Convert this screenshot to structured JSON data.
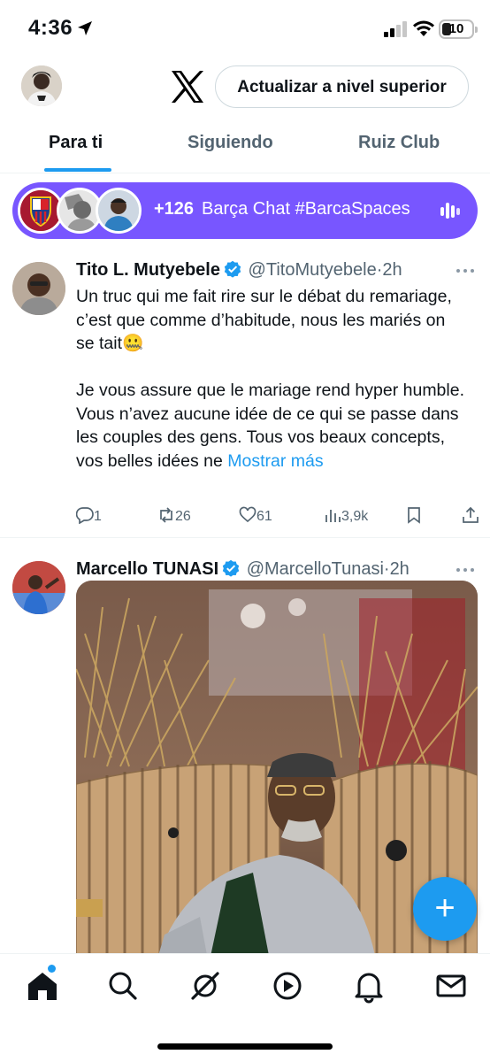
{
  "status_bar": {
    "time": "4:36",
    "battery": "10"
  },
  "header": {
    "upgrade_label": "Actualizar a nivel superior"
  },
  "tabs": [
    {
      "label": "Para ti",
      "active": true
    },
    {
      "label": "Siguiendo",
      "active": false
    },
    {
      "label": "Ruiz Club",
      "active": false
    }
  ],
  "spaces": {
    "count": "+126",
    "title": "Barça Chat #BarcaSpaces",
    "color": "#7856ff"
  },
  "tweets": [
    {
      "name": "Tito L. Mutyebele",
      "handle": "@TitoMutyebele",
      "time": "2h",
      "text": "Un truc qui me fait rire sur le débat du remariage, c’est que comme d’habitude, nous les mariés on se tait🤐\n\nJe vous assure que le mariage rend hyper humble. Vous n’avez aucune idée de ce qui se passe dans les couples des gens. Tous vos beaux concepts, vos belles idées ne ",
      "show_more": "Mostrar más",
      "replies": "1",
      "reposts": "26",
      "likes": "61",
      "views": "3,9k"
    },
    {
      "name": "Marcello TUNASI",
      "handle": "@MarcelloTunasi",
      "time": "2h"
    }
  ],
  "colors": {
    "accent": "#1d9bf0",
    "text": "#0f1419",
    "secondary": "#536471"
  }
}
